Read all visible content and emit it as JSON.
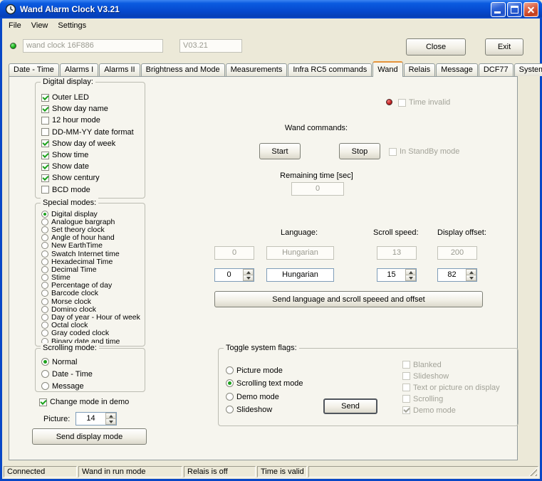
{
  "colors": {
    "titlebar_blue": "#0A50D8",
    "led_green": "#1DB31D",
    "led_red": "#C42222",
    "tab_active_accent": "#E5933A",
    "form_background": "#ECE9D8"
  },
  "window": {
    "title": "Wand Alarm Clock V3.21"
  },
  "menu": {
    "items": [
      {
        "label": "File"
      },
      {
        "label": "View"
      },
      {
        "label": "Settings"
      }
    ]
  },
  "header": {
    "device": "wand clock 16F886",
    "version": "V03.21",
    "close": "Close",
    "exit": "Exit"
  },
  "tabs": {
    "active": "Wand",
    "items": [
      {
        "label": "Date - Time"
      },
      {
        "label": "Alarms I"
      },
      {
        "label": "Alarms II"
      },
      {
        "label": "Brightness and Mode"
      },
      {
        "label": "Measurements"
      },
      {
        "label": "Infra RC5 commands"
      },
      {
        "label": "Wand"
      },
      {
        "label": "Relais"
      },
      {
        "label": "Message"
      },
      {
        "label": "DCF77"
      },
      {
        "label": "System"
      }
    ]
  },
  "digital": {
    "title": "Digital display:",
    "items": [
      {
        "label": "Outer LED",
        "checked": true
      },
      {
        "label": "Show day name",
        "checked": true
      },
      {
        "label": "12 hour mode",
        "checked": false
      },
      {
        "label": "DD-MM-YY date format",
        "checked": false
      },
      {
        "label": "Show day of week",
        "checked": true
      },
      {
        "label": "Show time",
        "checked": true
      },
      {
        "label": "Show date",
        "checked": true
      },
      {
        "label": "Show century",
        "checked": true
      },
      {
        "label": "BCD mode",
        "checked": false
      }
    ]
  },
  "special": {
    "title": "Special modes:",
    "items": [
      {
        "label": "Digital display",
        "selected": true
      },
      {
        "label": "Analogue bargraph",
        "selected": false
      },
      {
        "label": "Set theory clock",
        "selected": false
      },
      {
        "label": "Angle of hour hand",
        "selected": false
      },
      {
        "label": "New EarthTime",
        "selected": false
      },
      {
        "label": "Swatch Internet time",
        "selected": false
      },
      {
        "label": "Hexadecimal Time",
        "selected": false
      },
      {
        "label": "Decimal Time",
        "selected": false
      },
      {
        "label": "Stime",
        "selected": false
      },
      {
        "label": "Percentage of day",
        "selected": false
      },
      {
        "label": "Barcode clock",
        "selected": false
      },
      {
        "label": "Morse clock",
        "selected": false
      },
      {
        "label": "Domino clock",
        "selected": false
      },
      {
        "label": "Day of year - Hour of week",
        "selected": false
      },
      {
        "label": "Octal clock",
        "selected": false
      },
      {
        "label": "Gray coded clock",
        "selected": false
      },
      {
        "label": "Binary date and time",
        "selected": false
      }
    ]
  },
  "scrollmode": {
    "title": "Scrolling mode:",
    "items": [
      {
        "label": "Normal",
        "selected": true
      },
      {
        "label": "Date - Time",
        "selected": false
      },
      {
        "label": "Message",
        "selected": false
      }
    ]
  },
  "demo": {
    "label": "Change mode in demo",
    "checked": true
  },
  "picture": {
    "label": "Picture:",
    "value": "14"
  },
  "send_display": {
    "label": "Send display mode"
  },
  "wand": {
    "time_invalid": {
      "label": "Time invalid",
      "checked": false
    },
    "commands_label": "Wand commands:",
    "start": "Start",
    "stop": "Stop",
    "standby": {
      "label": "In StandBy mode",
      "checked": false
    },
    "remaining_label": "Remaining time [sec]",
    "remaining_value": "0",
    "language_label": "Language:",
    "scroll_label": "Scroll speed:",
    "offset_label": "Display offset:",
    "row1": {
      "num": "0",
      "lang": "Hungarian",
      "speed": "13",
      "offset": "200"
    },
    "row2": {
      "num": "0",
      "lang": "Hungarian",
      "speed": "15",
      "offset": "82"
    },
    "send_language": "Send language and scroll speeed and offset"
  },
  "flags": {
    "title": "Toggle system flags:",
    "radios": [
      {
        "label": "Picture mode",
        "selected": false
      },
      {
        "label": "Scrolling text mode",
        "selected": true
      },
      {
        "label": "Demo mode",
        "selected": false
      },
      {
        "label": "Slideshow",
        "selected": false
      }
    ],
    "send": "Send",
    "checks": [
      {
        "label": "Blanked",
        "checked": false
      },
      {
        "label": "Slideshow",
        "checked": false
      },
      {
        "label": "Text or picture on display",
        "checked": false
      },
      {
        "label": "Scrolling",
        "checked": false
      },
      {
        "label": "Demo mode",
        "checked": true
      }
    ]
  },
  "status": {
    "items": [
      {
        "text": "Connected"
      },
      {
        "text": "Wand in run mode"
      },
      {
        "text": "Relais is off"
      },
      {
        "text": "Time is valid"
      }
    ]
  }
}
